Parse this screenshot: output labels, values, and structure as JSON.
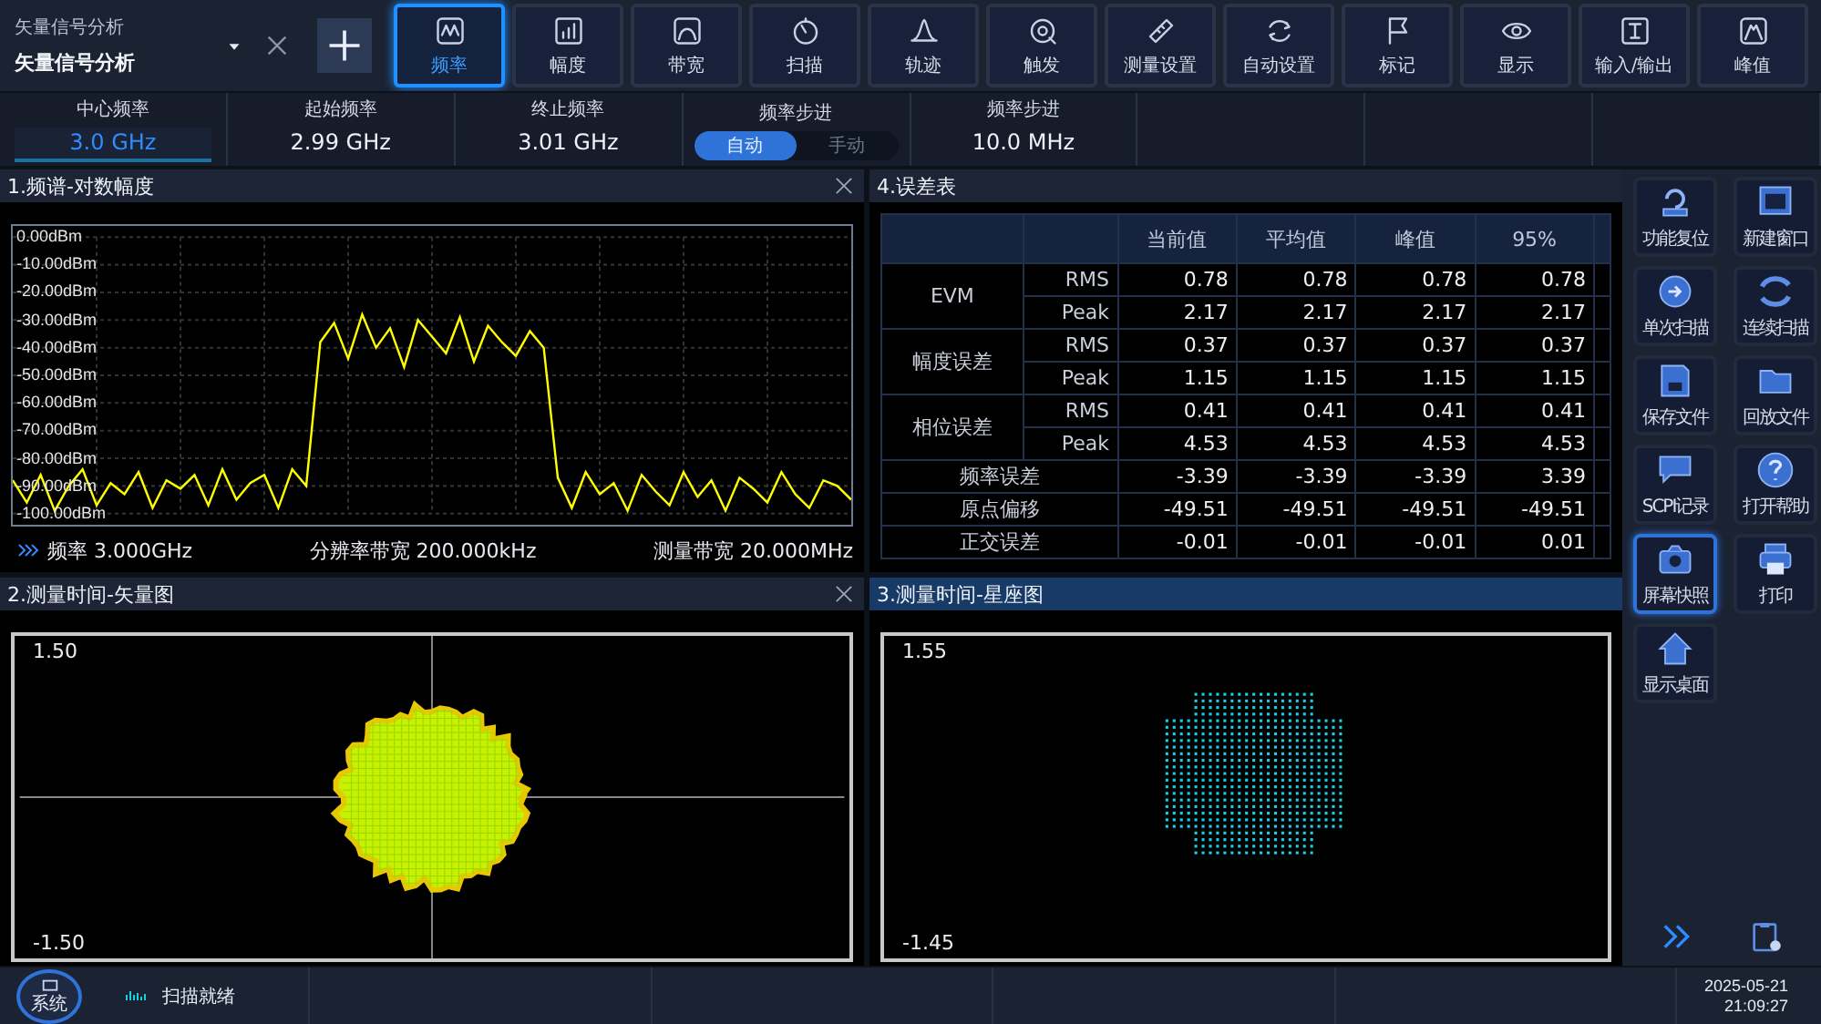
{
  "app_selector": {
    "caption": "矢量信号分析",
    "title": "矢量信号分析"
  },
  "toolbar": [
    {
      "label": "频率",
      "selected": true
    },
    {
      "label": "幅度",
      "selected": false
    },
    {
      "label": "带宽",
      "selected": false
    },
    {
      "label": "扫描",
      "selected": false
    },
    {
      "label": "轨迹",
      "selected": false
    },
    {
      "label": "触发",
      "selected": false
    },
    {
      "label": "测量设置",
      "selected": false
    },
    {
      "label": "自动设置",
      "selected": false
    },
    {
      "label": "标记",
      "selected": false
    },
    {
      "label": "显示",
      "selected": false
    },
    {
      "label": "输入/输出",
      "selected": false
    },
    {
      "label": "峰值",
      "selected": false
    }
  ],
  "params": [
    {
      "kind": "value",
      "label": "中心频率",
      "value": "3.0 GHz",
      "selected": true
    },
    {
      "kind": "value",
      "label": "起始频率",
      "value": "2.99 GHz",
      "selected": false
    },
    {
      "kind": "value",
      "label": "终止频率",
      "value": "3.01 GHz",
      "selected": false
    },
    {
      "kind": "toggle",
      "label": "频率步进",
      "options": [
        {
          "label": "自动",
          "selected": true
        },
        {
          "label": "手动",
          "selected": false
        }
      ]
    },
    {
      "kind": "value",
      "label": "频率步进",
      "value": "10.0 MHz",
      "selected": false
    }
  ],
  "windows": [
    {
      "kind": "spectrum",
      "title": "1.频谱-对数幅度",
      "selected": false,
      "closable": true,
      "chart_data": {
        "type": "line",
        "grid": true,
        "ylim": [
          -100,
          0
        ],
        "yticks": [
          {
            "value": 0,
            "label": "0.00dBm"
          },
          {
            "value": -10,
            "label": "-10.00dBm"
          },
          {
            "value": -20,
            "label": "-20.00dBm"
          },
          {
            "value": -30,
            "label": "-30.00dBm"
          },
          {
            "value": -40,
            "label": "-40.00dBm"
          },
          {
            "value": -50,
            "label": "-50.00dBm"
          },
          {
            "value": -60,
            "label": "-60.00dBm"
          },
          {
            "value": -70,
            "label": "-70.00dBm"
          },
          {
            "value": -80,
            "label": "-80.00dBm"
          },
          {
            "value": -90,
            "label": "-90.00dBm"
          },
          {
            "value": -100,
            "label": "-100.00dBm"
          }
        ],
        "series": [
          {
            "color": "#ffff00",
            "values": [
              -88,
              -96,
              -86,
              -99,
              -90,
              -84,
              -97,
              -89,
              -93,
              -85,
              -98,
              -88,
              -91,
              -86,
              -97,
              -84,
              -95,
              -89,
              -86,
              -98,
              -84,
              -90,
              -38,
              -31,
              -44,
              -28,
              -40,
              -33,
              -47,
              -30,
              -36,
              -42,
              -29,
              -45,
              -32,
              -38,
              -43,
              -34,
              -40,
              -87,
              -98,
              -85,
              -93,
              -89,
              -99,
              -86,
              -92,
              -97,
              -85,
              -94,
              -88,
              -99,
              -87,
              -91,
              -96,
              -85,
              -93,
              -98,
              -88,
              -90,
              -95
            ]
          }
        ]
      },
      "footer": [
        "频率 3.000GHz",
        "分辨率带宽 200.000kHz",
        "测量带宽 20.000MHz"
      ]
    },
    {
      "kind": "table",
      "title": "4.误差表",
      "selected": false,
      "closable": false,
      "columns": [
        "当前值",
        "平均值",
        "峰值",
        "95%"
      ],
      "groups": [
        {
          "label": "EVM",
          "rows": [
            {
              "sub": "RMS",
              "values": [
                "0.78",
                "0.78",
                "0.78",
                "0.78"
              ]
            },
            {
              "sub": "Peak",
              "values": [
                "2.17",
                "2.17",
                "2.17",
                "2.17"
              ]
            }
          ]
        },
        {
          "label": "幅度误差",
          "rows": [
            {
              "sub": "RMS",
              "values": [
                "0.37",
                "0.37",
                "0.37",
                "0.37"
              ]
            },
            {
              "sub": "Peak",
              "values": [
                "1.15",
                "1.15",
                "1.15",
                "1.15"
              ]
            }
          ]
        },
        {
          "label": "相位误差",
          "rows": [
            {
              "sub": "RMS",
              "values": [
                "0.41",
                "0.41",
                "0.41",
                "0.41"
              ]
            },
            {
              "sub": "Peak",
              "values": [
                "4.53",
                "4.53",
                "4.53",
                "4.53"
              ]
            }
          ]
        },
        {
          "label": "频率误差",
          "rows": [
            {
              "values": [
                "-3.39",
                "-3.39",
                "-3.39",
                "3.39"
              ]
            }
          ]
        },
        {
          "label": "原点偏移",
          "rows": [
            {
              "values": [
                "-49.51",
                "-49.51",
                "-49.51",
                "-49.51"
              ]
            }
          ]
        },
        {
          "label": "正交误差",
          "rows": [
            {
              "values": [
                "-0.01",
                "-0.01",
                "-0.01",
                "0.01"
              ]
            }
          ]
        }
      ]
    },
    {
      "kind": "vector",
      "title": "2.测量时间-矢量图",
      "selected": false,
      "closable": true,
      "y_max": "1.50",
      "y_min": "-1.50"
    },
    {
      "kind": "constellation",
      "title": "3.测量时间-星座图",
      "selected": true,
      "closable": false,
      "y_max": "1.55",
      "y_min": "-1.45"
    }
  ],
  "sidebar": [
    {
      "label": "功能复位",
      "selected": false
    },
    {
      "label": "新建窗口",
      "selected": false
    },
    {
      "label": "单次扫描",
      "selected": false
    },
    {
      "label": "连续扫描",
      "selected": false
    },
    {
      "label": "保存文件",
      "selected": false
    },
    {
      "label": "回放文件",
      "selected": false
    },
    {
      "label": "SCPI记录",
      "selected": false
    },
    {
      "label": "打开帮助",
      "selected": false
    },
    {
      "label": "屏幕快照",
      "selected": true
    },
    {
      "label": "打印",
      "selected": false
    },
    {
      "label": "显示桌面",
      "selected": false
    }
  ],
  "status_bar": {
    "system": "系统",
    "status": "扫描就绪",
    "date": "2025-05-21",
    "time": "21:09:27"
  }
}
